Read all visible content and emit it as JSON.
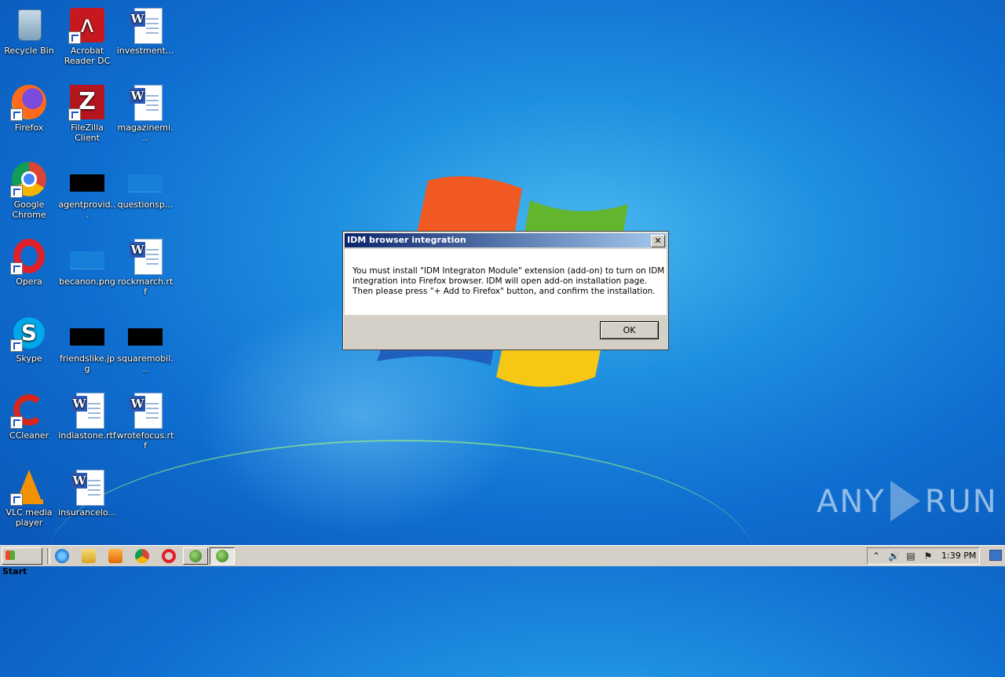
{
  "desktop": {
    "icons": [
      {
        "label": "Recycle Bin"
      },
      {
        "label": "Acrobat Reader DC"
      },
      {
        "label": "investment..."
      },
      {
        "label": "Firefox"
      },
      {
        "label": "FileZilla Client"
      },
      {
        "label": "magazinemi..."
      },
      {
        "label": "Google Chrome"
      },
      {
        "label": "agentprovid..."
      },
      {
        "label": "questionsp..."
      },
      {
        "label": "Opera"
      },
      {
        "label": "becanon.png"
      },
      {
        "label": "rockmarch.rtf"
      },
      {
        "label": "Skype"
      },
      {
        "label": "friendslike.jpg"
      },
      {
        "label": "squaremobil..."
      },
      {
        "label": "CCleaner"
      },
      {
        "label": "indiastone.rtf"
      },
      {
        "label": "wrotefocus.rtf"
      },
      {
        "label": "VLC media player"
      },
      {
        "label": "insurancelo..."
      }
    ]
  },
  "dialog": {
    "title": "IDM browser integration",
    "close_glyph": "✕",
    "message_lines": [
      "You must install \"IDM Integraton Module\" extension (add-on) to turn on IDM",
      "integration into Firefox browser. IDM will open add-on installation page.",
      "Then please press \"+ Add to Firefox\" button, and confirm the installation."
    ],
    "ok_label": "OK"
  },
  "taskbar": {
    "start_label": "Start",
    "clock": "1:39 PM"
  },
  "watermark": {
    "left": "ANY",
    "right": "RUN"
  },
  "colors": {
    "titlebar_start": "#0a246a",
    "titlebar_end": "#a6caf0",
    "desktop": "#1f8fe0",
    "taskbar": "#d4d0c8"
  }
}
